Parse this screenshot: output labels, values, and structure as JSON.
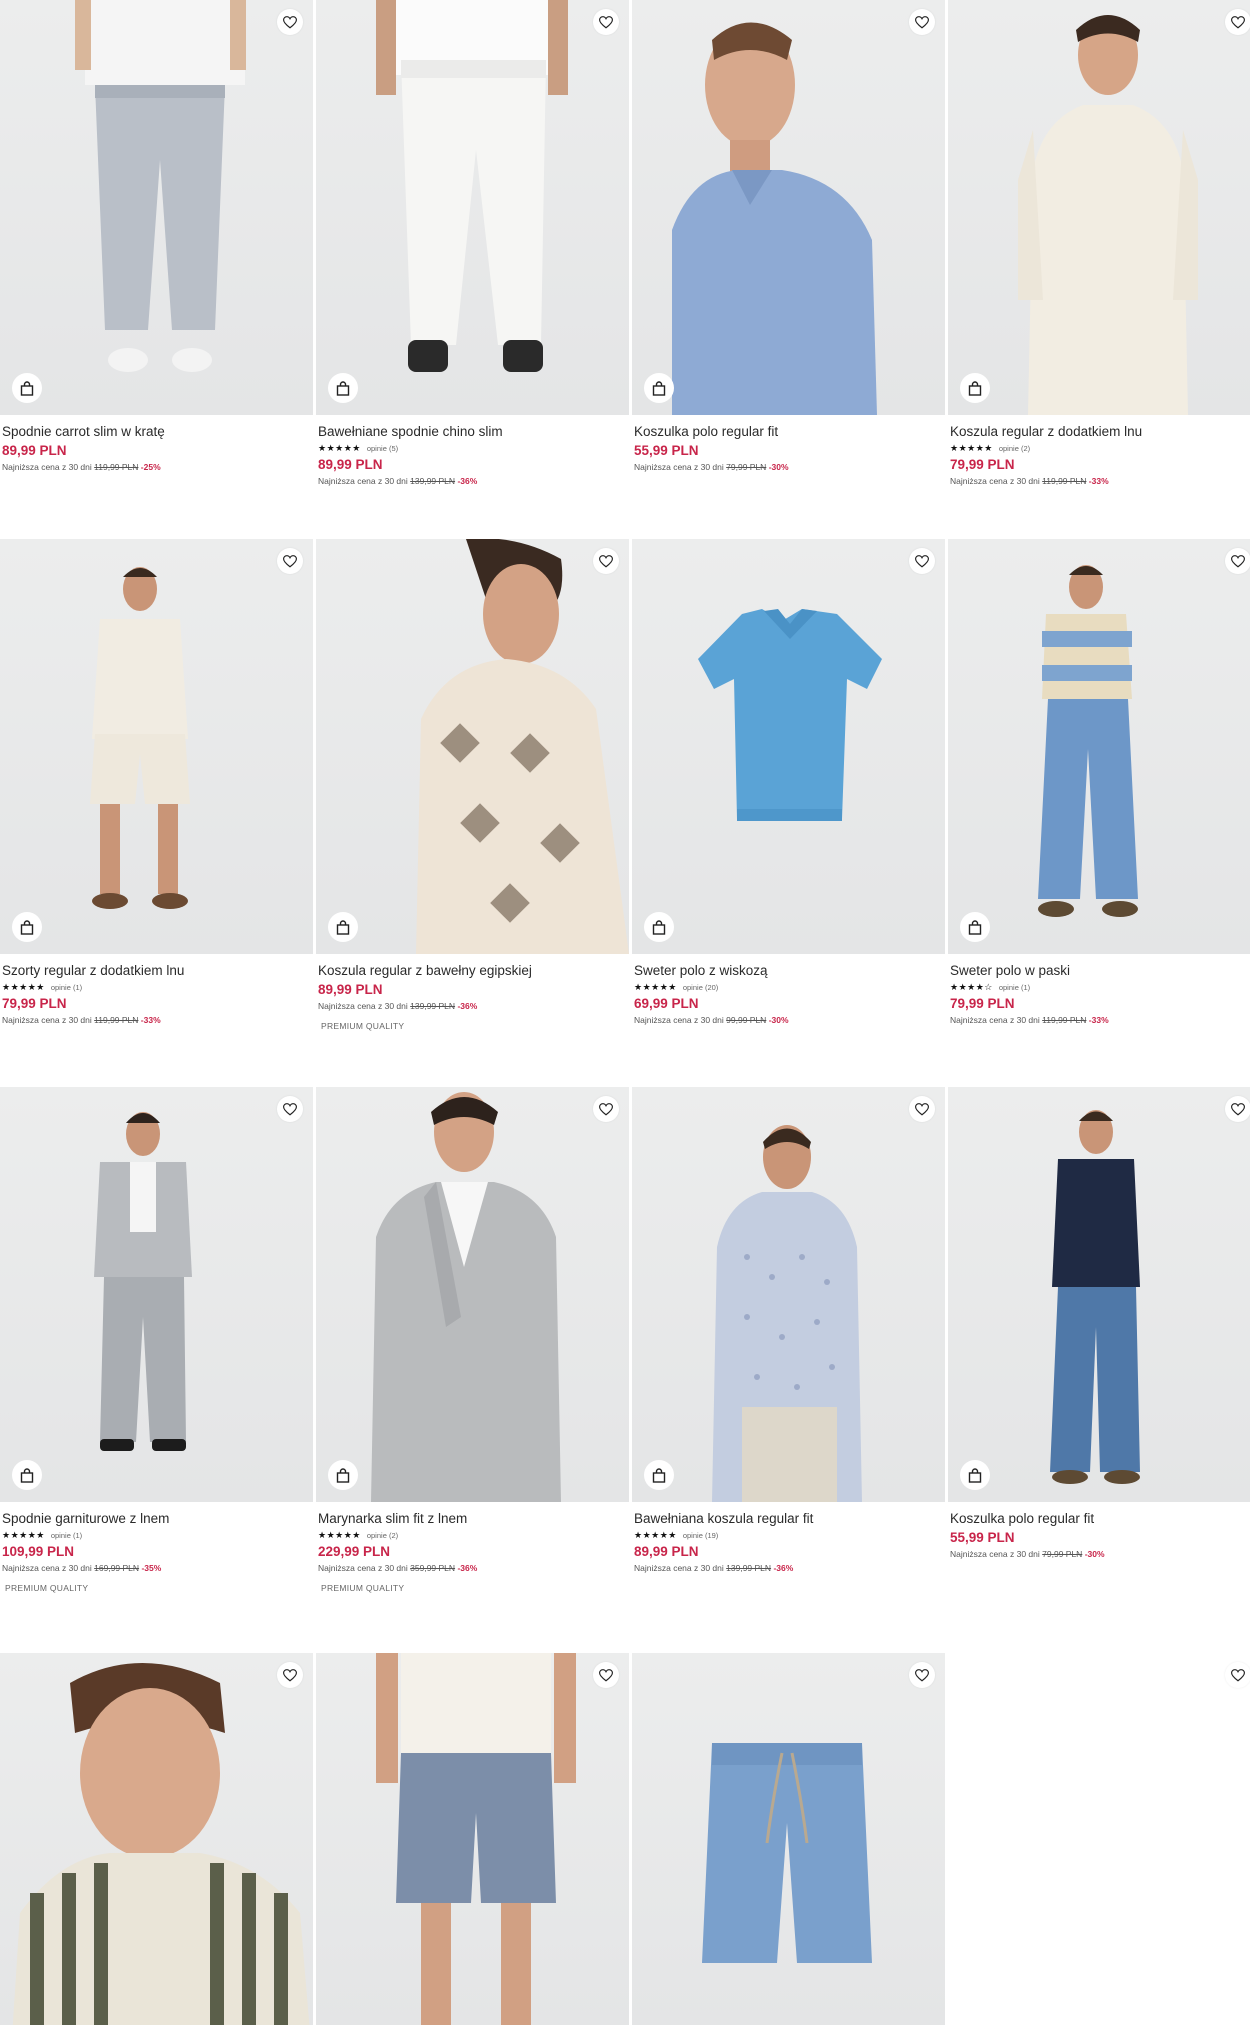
{
  "icons": {
    "favorite": "heart-outline-icon",
    "bag": "shopping-bag-icon"
  },
  "colors": {
    "price": "#c8254a",
    "discount": "#c8254a",
    "image_bg": "#e8e9ea"
  },
  "products": [
    {
      "title": "Spodnie carrot slim w kratę",
      "stars": "",
      "reviews": "",
      "price": "89,99 PLN",
      "lowest_label": "Najniższa cena z 30 dni",
      "old_price": "119,99 PLN",
      "discount": "-25%",
      "badge": ""
    },
    {
      "title": "Bawełniane spodnie chino slim",
      "stars": "★★★★★",
      "reviews": "opinie (5)",
      "price": "89,99 PLN",
      "lowest_label": "Najniższa cena z 30 dni",
      "old_price": "139,99 PLN",
      "discount": "-36%",
      "badge": ""
    },
    {
      "title": "Koszulka polo regular fit",
      "stars": "",
      "reviews": "",
      "price": "55,99 PLN",
      "lowest_label": "Najniższa cena z 30 dni",
      "old_price": "79,99 PLN",
      "discount": "-30%",
      "badge": ""
    },
    {
      "title": "Koszula regular z dodatkiem lnu",
      "stars": "★★★★★",
      "reviews": "opinie (2)",
      "price": "79,99 PLN",
      "lowest_label": "Najniższa cena z 30 dni",
      "old_price": "119,99 PLN",
      "discount": "-33%",
      "badge": ""
    },
    {
      "title": "Szorty regular z dodatkiem lnu",
      "stars": "★★★★★",
      "reviews": "opinie (1)",
      "price": "79,99 PLN",
      "lowest_label": "Najniższa cena z 30 dni",
      "old_price": "119,99 PLN",
      "discount": "-33%",
      "badge": ""
    },
    {
      "title": "Koszula regular z bawełny egipskiej",
      "stars": "",
      "reviews": "",
      "price": "89,99 PLN",
      "lowest_label": "Najniższa cena z 30 dni",
      "old_price": "139,99 PLN",
      "discount": "-36%",
      "badge": "PREMIUM QUALITY"
    },
    {
      "title": "Sweter polo z wiskozą",
      "stars": "★★★★★",
      "reviews": "opinie (20)",
      "price": "69,99 PLN",
      "lowest_label": "Najniższa cena z 30 dni",
      "old_price": "99,99 PLN",
      "discount": "-30%",
      "badge": ""
    },
    {
      "title": "Sweter polo w paski",
      "stars": "★★★★☆",
      "reviews": "opinie (1)",
      "price": "79,99 PLN",
      "lowest_label": "Najniższa cena z 30 dni",
      "old_price": "119,99 PLN",
      "discount": "-33%",
      "badge": ""
    },
    {
      "title": "Spodnie garniturowe z lnem",
      "stars": "★★★★★",
      "reviews": "opinie (1)",
      "price": "109,99 PLN",
      "lowest_label": "Najniższa cena z 30 dni",
      "old_price": "169,99 PLN",
      "discount": "-35%",
      "badge": "PREMIUM QUALITY"
    },
    {
      "title": "Marynarka slim fit z lnem",
      "stars": "★★★★★",
      "reviews": "opinie (2)",
      "price": "229,99 PLN",
      "lowest_label": "Najniższa cena z 30 dni",
      "old_price": "359,99 PLN",
      "discount": "-36%",
      "badge": "PREMIUM QUALITY"
    },
    {
      "title": "Bawełniana koszula regular fit",
      "stars": "★★★★★",
      "reviews": "opinie (19)",
      "price": "89,99 PLN",
      "lowest_label": "Najniższa cena z 30 dni",
      "old_price": "139,99 PLN",
      "discount": "-36%",
      "badge": ""
    },
    {
      "title": "Koszulka polo regular fit",
      "stars": "",
      "reviews": "",
      "price": "55,99 PLN",
      "lowest_label": "Najniższa cena z 30 dni",
      "old_price": "79,99 PLN",
      "discount": "-30%",
      "badge": ""
    }
  ]
}
